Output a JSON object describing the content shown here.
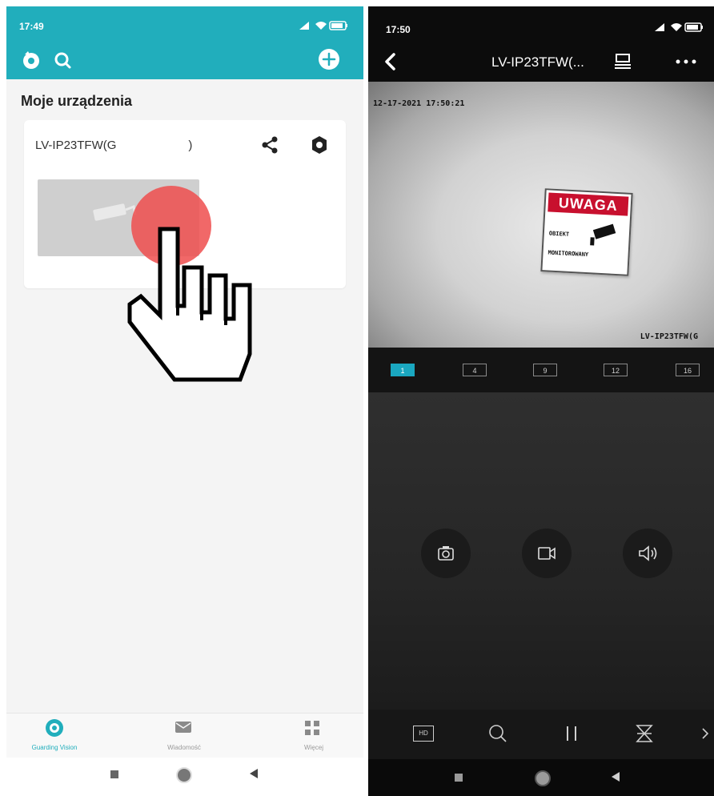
{
  "left_screen": {
    "status_bar": {
      "time": "17:49",
      "signal_icon": "cell-signal-icon",
      "wifi_icon": "wifi-icon",
      "battery_icon": "battery-icon",
      "battery_level": "61"
    },
    "header": {
      "left_icons": [
        "camera-scan-icon",
        "search-icon"
      ],
      "add_icon": "add-device-icon"
    },
    "section_title": "Moje urządzenia",
    "device_card": {
      "device_name": "LV-IP23TFW(G",
      "device_name_suffix": ")",
      "share_icon": "share-icon",
      "settings_icon": "settings-icon",
      "thumbnail_icon": "camera-icon"
    },
    "bottom_tabs": [
      {
        "label": "Guarding Vision",
        "icon": "guarding-vision-icon",
        "active": true
      },
      {
        "label": "Wiadomość",
        "icon": "message-icon",
        "active": false
      },
      {
        "label": "Więcej",
        "icon": "more-grid-icon",
        "active": false
      }
    ],
    "accent_color": "#21aebc",
    "overlay": {
      "tap_circle_color": "#ee4d4d",
      "hand_icon": "pointer-hand-icon"
    }
  },
  "right_screen": {
    "status_bar": {
      "time": "17:50",
      "battery_level": "61"
    },
    "header": {
      "title": "LV-IP23TFW(...",
      "back_icon": "back-arrow-icon",
      "device_list_icon": "device-list-icon",
      "more_icon": "more-dots-icon"
    },
    "video": {
      "osd_timestamp": "12-17-2021 17:50:21",
      "osd_camera_name": "LV-IP23TFW(G",
      "sign": {
        "title": "UWAGA",
        "line1": "OBIEKT",
        "line2": "MONITOROWANY"
      }
    },
    "layout_options": [
      "1",
      "4",
      "9",
      "12",
      "16"
    ],
    "layout_active": "1",
    "center_controls": [
      {
        "name": "snapshot",
        "icon": "camera-snapshot-icon"
      },
      {
        "name": "record",
        "icon": "video-record-icon"
      },
      {
        "name": "audio",
        "icon": "speaker-icon"
      }
    ],
    "toolbar_icons": [
      "hd-icon",
      "zoom-icon",
      "pause-icon",
      "ptz-icon",
      "chevron-right-icon"
    ],
    "toolbar_labels": {
      "hd": "HD"
    },
    "accent_color": "#1aa7c0"
  }
}
